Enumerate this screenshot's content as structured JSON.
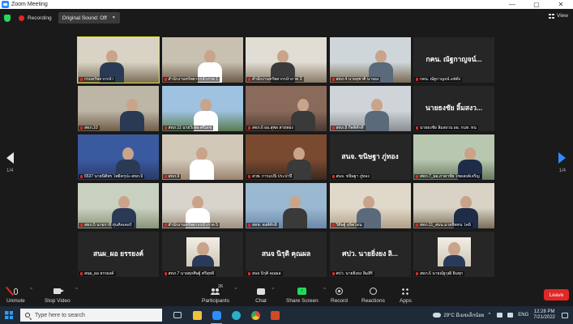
{
  "window": {
    "title": "Zoom Meeting",
    "controls": {
      "minimize": "—",
      "maximize": "▢",
      "close": "✕"
    }
  },
  "topbar": {
    "recording_label": "Recording",
    "original_sound": "Original Sound: Off",
    "view_label": "View"
  },
  "pagination": {
    "left": "1/4",
    "right": "1/4"
  },
  "tiles": [
    {
      "name": "กรมทรัพยากรน้ำ",
      "kind": "video",
      "active": true
    },
    {
      "name": "สำนักงานทรัพยากรน้ำภาค 1",
      "kind": "video"
    },
    {
      "name": "สำนักงานทรัพยากรน้ำภาค 3",
      "kind": "video"
    },
    {
      "name": "สทภ.4 นายสุชาติ นาจอง",
      "kind": "video"
    },
    {
      "name": "กคน. ณัฐกาญจน์ แซ่ตั้ง",
      "kind": "text",
      "big": "กคน. ณัฐกาญจน์..."
    },
    {
      "name": "สทภ.10",
      "kind": "video"
    },
    {
      "name": "สทภ.11 นายวิเชษ ศรีเดช",
      "kind": "video"
    },
    {
      "name": "สทภ.6 ผอ.สุพล สายทอง",
      "kind": "video"
    },
    {
      "name": "สทภ.8 กิตติศักดิ์",
      "kind": "video"
    },
    {
      "name": "นายธงชัย ลิ้มสงวน ผอ. กนท. ทน",
      "kind": "text",
      "big": "นายธงชัย ลิ้มสงว..."
    },
    {
      "name": "6537 นายนิติพร โพธิ์ครุปะ-สทภ.9",
      "kind": "video"
    },
    {
      "name": "สทภ.9",
      "kind": "video"
    },
    {
      "name": "สวพ. การแปนิ ประปาปี",
      "kind": "video"
    },
    {
      "name": "สนจ. ขนิษฐา ภู่ทอง",
      "kind": "text",
      "big": "สนจ. ขนิษฐา ภู่ทอง"
    },
    {
      "name": "สทภ.7_ผอ.ภาดาชัย โชคสงค์เจริญ",
      "kind": "video"
    },
    {
      "name": "สทภ.5 นายกาจี หุ่นคิดเคอร์",
      "kind": "video"
    },
    {
      "name": "สำนักงานทรัพยากรน้ำภาค 5",
      "kind": "video"
    },
    {
      "name": "สทพ. พงศ์ศักดิ์",
      "kind": "video"
    },
    {
      "name": "วิศิษฐ์ สุจิตโดน",
      "kind": "video"
    },
    {
      "name": "สทภ.11_สบน.นายชิตทน โคอิ",
      "kind": "video"
    },
    {
      "name": "สนผ_ผอ ยรรยงค์",
      "kind": "text",
      "big": "สนผ_ผอ ยรรยงค์"
    },
    {
      "name": "สทภ.7 นายศุภศิษฐ์ ศรีสุทธิ์",
      "kind": "photo"
    },
    {
      "name": "สนจ นิรุติ คุณผล",
      "kind": "text",
      "big": "สนจ นิรุติ คุณผล"
    },
    {
      "name": "ศปว. นายยิ่งยง ลิ้มสิริ",
      "kind": "text",
      "big": "ศปว. นายยิ่งยง ลิ..."
    },
    {
      "name": "สทภ.6 นายณัฐวุฒิ ธิมทุก",
      "kind": "photo"
    }
  ],
  "toolbar": {
    "unmute": "Unmute",
    "stop_video": "Stop Video",
    "participants": "Participants",
    "participants_count": "26",
    "chat": "Chat",
    "share_screen": "Share Screen",
    "record": "Record",
    "reactions": "Reactions",
    "apps": "Apps",
    "leave": "Leave"
  },
  "taskbar": {
    "search_placeholder": "Type here to search",
    "weather": "29°C มีเมฆเล็กน้อย",
    "lang": "ENG",
    "time": "12:28 PM",
    "date": "7/21/2022"
  },
  "colors": {
    "accent": "#2d8cff",
    "leave": "#e02828",
    "share": "#23d959",
    "active_speaker": "#e6e028"
  }
}
